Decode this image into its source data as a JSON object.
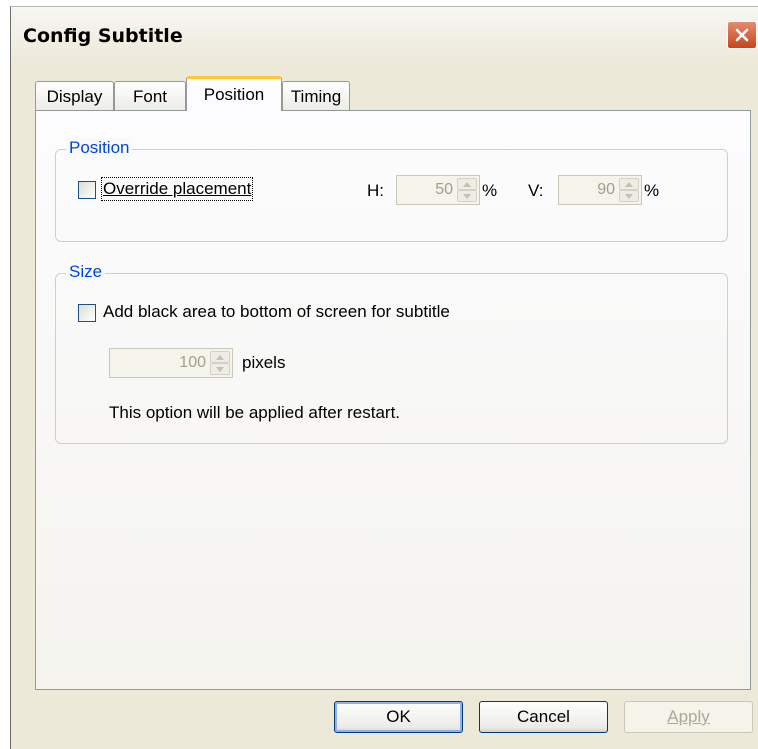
{
  "window": {
    "title": "Config Subtitle",
    "close_icon": "close-icon"
  },
  "tabs": [
    {
      "label": "Display",
      "selected": false
    },
    {
      "label": "Font",
      "selected": false
    },
    {
      "label": "Position",
      "selected": true
    },
    {
      "label": "Timing",
      "selected": false
    }
  ],
  "position_group": {
    "title": "Position",
    "override_label": "Override placement",
    "override_checked": false,
    "h_label": "H:",
    "h_value": "50",
    "h_unit": "%",
    "v_label": "V:",
    "v_value": "90",
    "v_unit": "%"
  },
  "size_group": {
    "title": "Size",
    "black_area_label": "Add black area to bottom of screen for subtitle",
    "black_area_checked": false,
    "pixels_value": "100",
    "pixels_unit": "pixels",
    "note": "This option will be applied after restart."
  },
  "buttons": {
    "ok": "OK",
    "cancel": "Cancel",
    "apply": "Apply"
  },
  "colors": {
    "group_title": "#0046d5",
    "dialog_bg": "#ece9d8",
    "close_button": "#c54520"
  }
}
